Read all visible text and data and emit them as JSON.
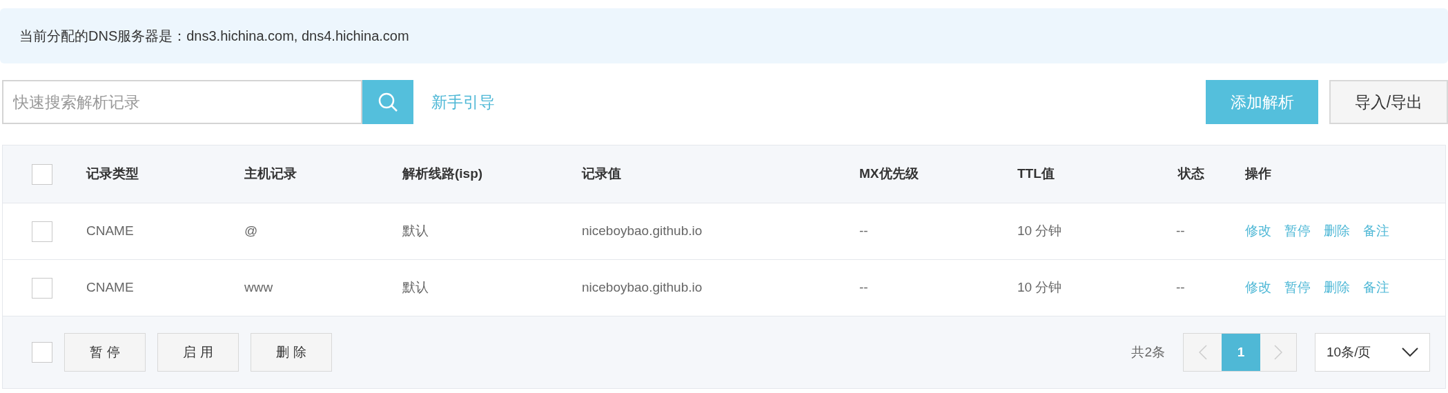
{
  "notice": "当前分配的DNS服务器是：dns3.hichina.com, dns4.hichina.com",
  "search": {
    "placeholder": "快速搜索解析记录"
  },
  "guide_link": "新手引导",
  "toolbar_buttons": [
    {
      "label": "添加解析",
      "kind": "primary"
    },
    {
      "label": "导入/导出",
      "kind": "default"
    }
  ],
  "table": {
    "select_all_checked": false,
    "columns": [
      "记录类型",
      "主机记录",
      "解析线路(isp)",
      "记录值",
      "MX优先级",
      "TTL值",
      "状态",
      "操作"
    ],
    "rows": [
      {
        "checked": false,
        "cells": [
          "CNAME",
          "@",
          "默认",
          "niceboybao.github.io",
          "--",
          "10 分钟",
          "--"
        ],
        "actions": [
          "修改",
          "暂停",
          "删除",
          "备注"
        ]
      },
      {
        "checked": false,
        "cells": [
          "CNAME",
          "www",
          "默认",
          "niceboybao.github.io",
          "--",
          "10 分钟",
          "--"
        ],
        "actions": [
          "修改",
          "暂停",
          "删除",
          "备注"
        ]
      }
    ]
  },
  "footer": {
    "select_all_checked": false,
    "bulk_buttons": [
      "暂 停",
      "启 用",
      "删 除"
    ],
    "total": "共2条",
    "pages": [
      {
        "label": "1",
        "selected": true
      }
    ],
    "page_size": "10条/页"
  }
}
